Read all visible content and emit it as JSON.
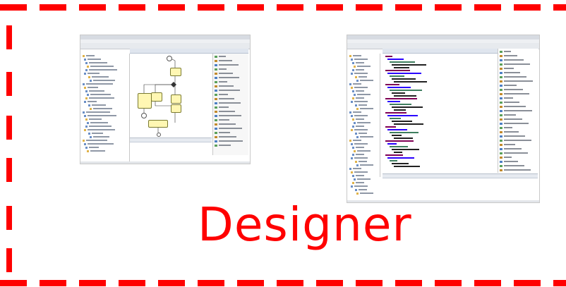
{
  "title": "Designer",
  "accent_color": "#ff0000",
  "screenshots": [
    {
      "kind": "diagram-editor"
    },
    {
      "kind": "code-editor"
    }
  ]
}
